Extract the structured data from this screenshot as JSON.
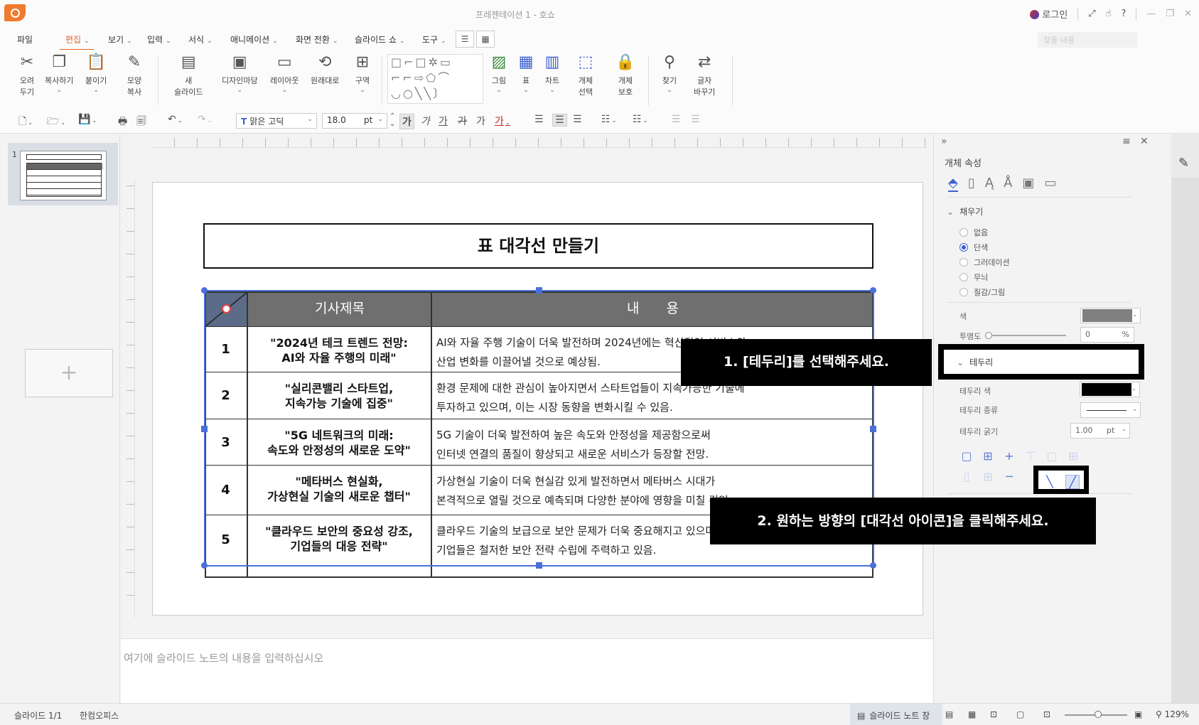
{
  "window": {
    "title": "프레젠테이션 1 - 호쇼",
    "login_label": "로그인",
    "controls": [
      "⤢",
      "☝",
      "?",
      "—",
      "❐",
      "✕"
    ]
  },
  "menu": {
    "items": [
      {
        "label": "파일",
        "caret": ""
      },
      {
        "label": "편집",
        "caret": "⌄",
        "active": true
      },
      {
        "label": "보기",
        "caret": "⌄"
      },
      {
        "label": "입력",
        "caret": "⌄"
      },
      {
        "label": "서식",
        "caret": "⌄"
      },
      {
        "label": "애니메이션",
        "caret": "⌄"
      },
      {
        "label": "화면 전환",
        "caret": "⌄"
      },
      {
        "label": "슬라이드 쇼",
        "caret": "⌄"
      },
      {
        "label": "도구",
        "caret": "⌄"
      }
    ],
    "search_placeholder": "찾을 내용"
  },
  "ribbon": {
    "buttons": [
      {
        "label": "오려\n두기",
        "icon": "scissors-icon",
        "glyph": "✂"
      },
      {
        "label": "복사하기",
        "icon": "copy-icon",
        "glyph": "❐"
      },
      {
        "label": "붙이기",
        "icon": "paste-icon",
        "glyph": "📋"
      },
      {
        "label": "모양\n복사",
        "icon": "format-painter-icon",
        "glyph": "✎"
      },
      {
        "label": "새\n슬라이드",
        "icon": "new-slide-icon",
        "glyph": "▤"
      },
      {
        "label": "디자인마당",
        "icon": "design-icon",
        "glyph": "▣"
      },
      {
        "label": "레이아웃",
        "icon": "layout-icon",
        "glyph": "▭"
      },
      {
        "label": "원래대로",
        "icon": "reset-icon",
        "glyph": "⟲"
      },
      {
        "label": "구역",
        "icon": "section-icon",
        "glyph": "⊞"
      },
      {
        "label": "그림",
        "icon": "picture-icon",
        "glyph": "▨"
      },
      {
        "label": "표",
        "icon": "table-icon",
        "glyph": "▦"
      },
      {
        "label": "차트",
        "icon": "chart-icon",
        "glyph": "▥"
      },
      {
        "label": "개체\n선택",
        "icon": "object-select-icon",
        "glyph": "⬚"
      },
      {
        "label": "개체\n보호",
        "icon": "object-protect-icon",
        "glyph": "🔒"
      },
      {
        "label": "찾기",
        "icon": "find-icon",
        "glyph": "⚲"
      },
      {
        "label": "글자\n바꾸기",
        "icon": "replace-icon",
        "glyph": "⇄"
      }
    ],
    "shapes_glyphs": "□⌐□✲▭\n⌐⌐⇨⬠⌒\n◡○╲╲〕"
  },
  "toolbar": {
    "font_name": "맑은 고딕",
    "font_size": "18.0",
    "font_unit": "pt",
    "bold_label": "가",
    "italic_label": "가",
    "underline_label": "가",
    "strike_label": "가",
    "shadow_label": "가"
  },
  "slide_panel": {
    "slide_number": "1",
    "add_symbol": "+"
  },
  "slide": {
    "title": "표 대각선 만들기",
    "header": {
      "col2": "기사제목",
      "col3": "내　　용"
    },
    "rows": [
      {
        "num": "1",
        "title_l1": "\"2024년 테크 트렌드 전망:",
        "title_l2": "AI와 자율 주행의 미래\"",
        "content_l1": "AI와 자율 주행 기술이 더욱 발전하며 2024년에는 혁신적인 서비스와",
        "content_l2": "산업 변화를 이끌어낼 것으로 예상됨."
      },
      {
        "num": "2",
        "title_l1": "\"실리콘밸리 스타트업,",
        "title_l2": "지속가능 기술에 집중\"",
        "content_l1": "환경 문제에 대한 관심이 높아지면서 스타트업들이 지속가능한 기술에",
        "content_l2": "투자하고 있으며, 이는 시장 동향을 변화시킬 수 있음."
      },
      {
        "num": "3",
        "title_l1": "\"5G 네트워크의 미래:",
        "title_l2": "속도와 안정성의 새로운 도약\"",
        "content_l1": "5G 기술이 더욱 발전하여 높은 속도와 안정성을 제공함으로써",
        "content_l2": "인터넷 연결의 품질이 향상되고 새로운 서비스가 등장할 전망."
      },
      {
        "num": "4",
        "title_l1": "\"메타버스 현실화,",
        "title_l2": "가상현실 기술의 새로운 챕터\"",
        "content_l1": "가상현실 기술이 더욱 현실감 있게 발전하면서 메타버스 시대가",
        "content_l2": "본격적으로 열릴 것으로 예측되며 다양한 분야에 영향을 미칠 것임."
      },
      {
        "num": "5",
        "title_l1": "\"클라우드 보안의 중요성 강조,",
        "title_l2": "기업들의 대응 전략\"",
        "content_l1": "클라우드 기술의 보급으로 보안 문제가 더욱 중요해지고 있으며,",
        "content_l2": "기업들은 철저한 보안 전략 수립에 주력하고 있음."
      }
    ]
  },
  "notes": {
    "placeholder": "여기에 슬라이드 노트의 내용을 입력하십시오"
  },
  "properties": {
    "title": "개체 속성",
    "fill_section": "채우기",
    "fill_options": [
      "없음",
      "단색",
      "그러데이션",
      "무늬",
      "질감/그림"
    ],
    "fill_selected": "단색",
    "color_label": "색",
    "fill_color": "#808080",
    "transparency_label": "투명도",
    "transparency_value": "0",
    "transparency_unit": "%",
    "border_section": "테두리",
    "border_color_label": "테두리 색",
    "border_color": "#000000",
    "border_type_label": "테두리 종류",
    "border_width_label": "테두리 굵기",
    "border_width_value": "1.00",
    "border_width_unit": "pt"
  },
  "callouts": {
    "step1": "1. [테두리]를 선택해주세요.",
    "step2": "2. 원하는 방향의 [대각선 아이콘]을 클릭해주세요."
  },
  "status": {
    "slide_info": "슬라이드 1/1",
    "app_name": "한컴오피스",
    "notes_toggle": "슬라이드 노트 창",
    "zoom": "129%"
  },
  "colors": {
    "accent": "#e8642c",
    "table_header": "#6f6f6f",
    "corner_cell": "#5c6b87",
    "selection": "#4a6fd8"
  }
}
